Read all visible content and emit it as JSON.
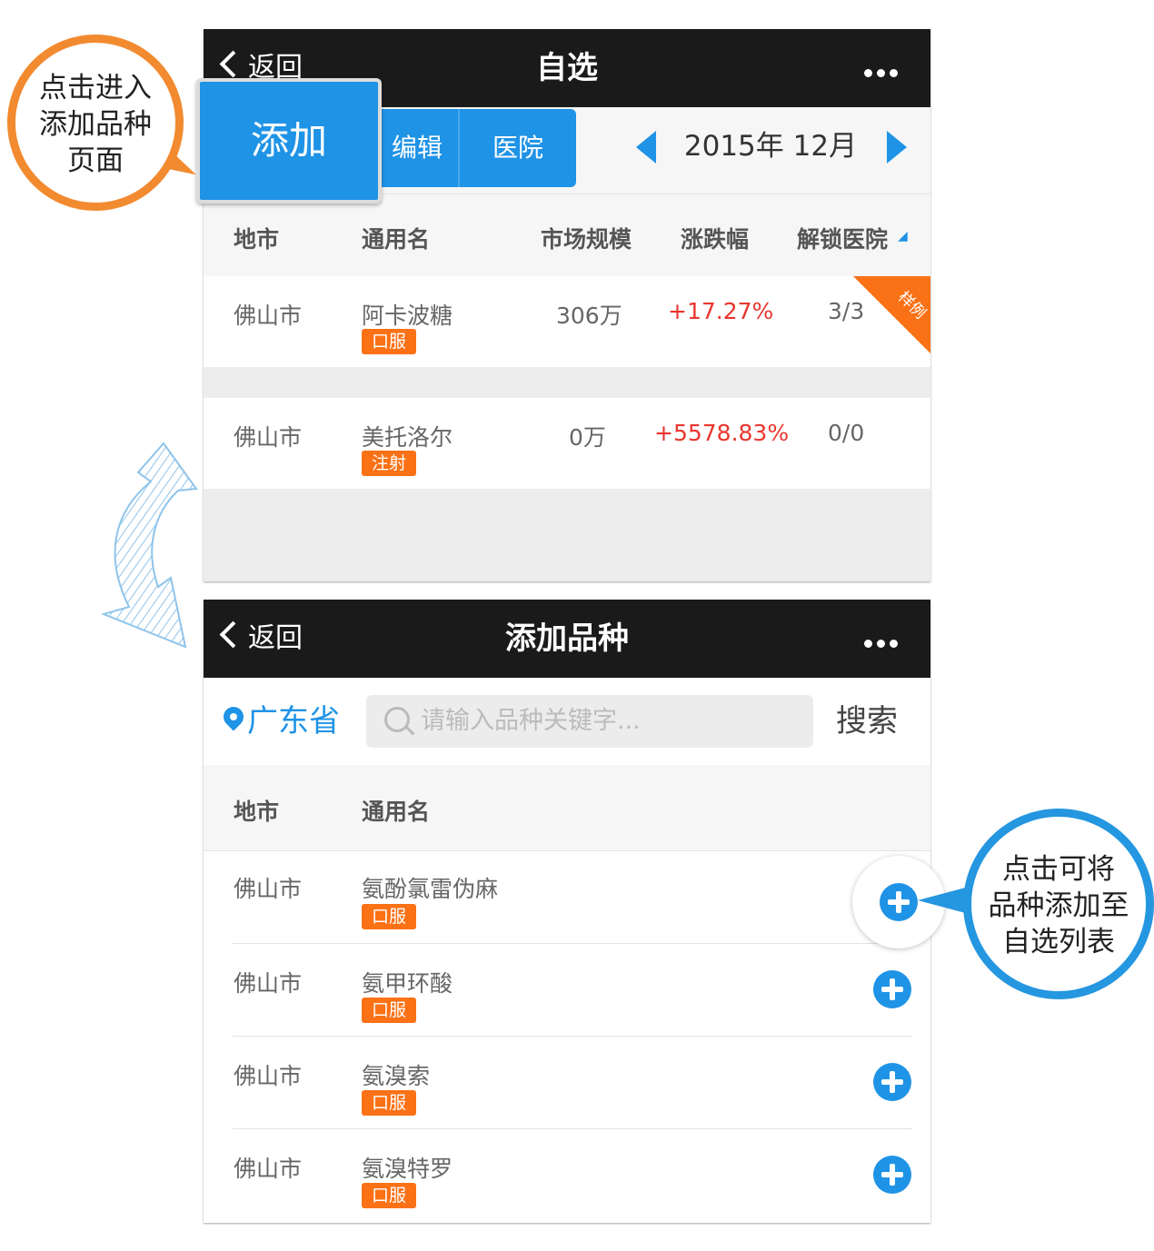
{
  "callouts": {
    "left": [
      "点击进入",
      "添加品种",
      "页面"
    ],
    "right": [
      "点击可将",
      "品种添加至",
      "自选列表"
    ]
  },
  "panel1": {
    "nav": {
      "back": "返回",
      "title": "自选"
    },
    "add_button": "添加",
    "edit_button": "编辑",
    "hospital_button": "医院",
    "month": "2015年 12月",
    "headers": [
      "地市",
      "通用名",
      "市场规模",
      "涨跌幅",
      "解锁医院"
    ],
    "sample_badge": "样例",
    "rows": [
      {
        "city": "佛山市",
        "name": "阿卡波糖",
        "tag": "口服",
        "size": "306万",
        "change": "+17.27%",
        "unlock": "3/3"
      },
      {
        "city": "佛山市",
        "name": "美托洛尔",
        "tag": "注射",
        "size": "0万",
        "change": "+5578.83%",
        "unlock": "0/0"
      }
    ]
  },
  "panel2": {
    "nav": {
      "back": "返回",
      "title": "添加品种"
    },
    "province": "广东省",
    "search_placeholder": "请输入品种关键字...",
    "search_button": "搜索",
    "headers": [
      "地市",
      "通用名"
    ],
    "rows": [
      {
        "city": "佛山市",
        "name": "氨酚氯雷伪麻",
        "tag": "口服"
      },
      {
        "city": "佛山市",
        "name": "氨甲环酸",
        "tag": "口服"
      },
      {
        "city": "佛山市",
        "name": "氨溴索",
        "tag": "口服"
      },
      {
        "city": "佛山市",
        "name": "氨溴特罗",
        "tag": "口服"
      }
    ]
  },
  "colors": {
    "accent": "#1f93e6",
    "tag": "#fa7116",
    "up": "#e8362e",
    "navbar": "#1a1a1a"
  },
  "icons": [
    "back-chevron-icon",
    "more-icon",
    "prev-month-icon",
    "next-month-icon",
    "location-pin-icon",
    "search-icon",
    "add-plus-icon"
  ]
}
